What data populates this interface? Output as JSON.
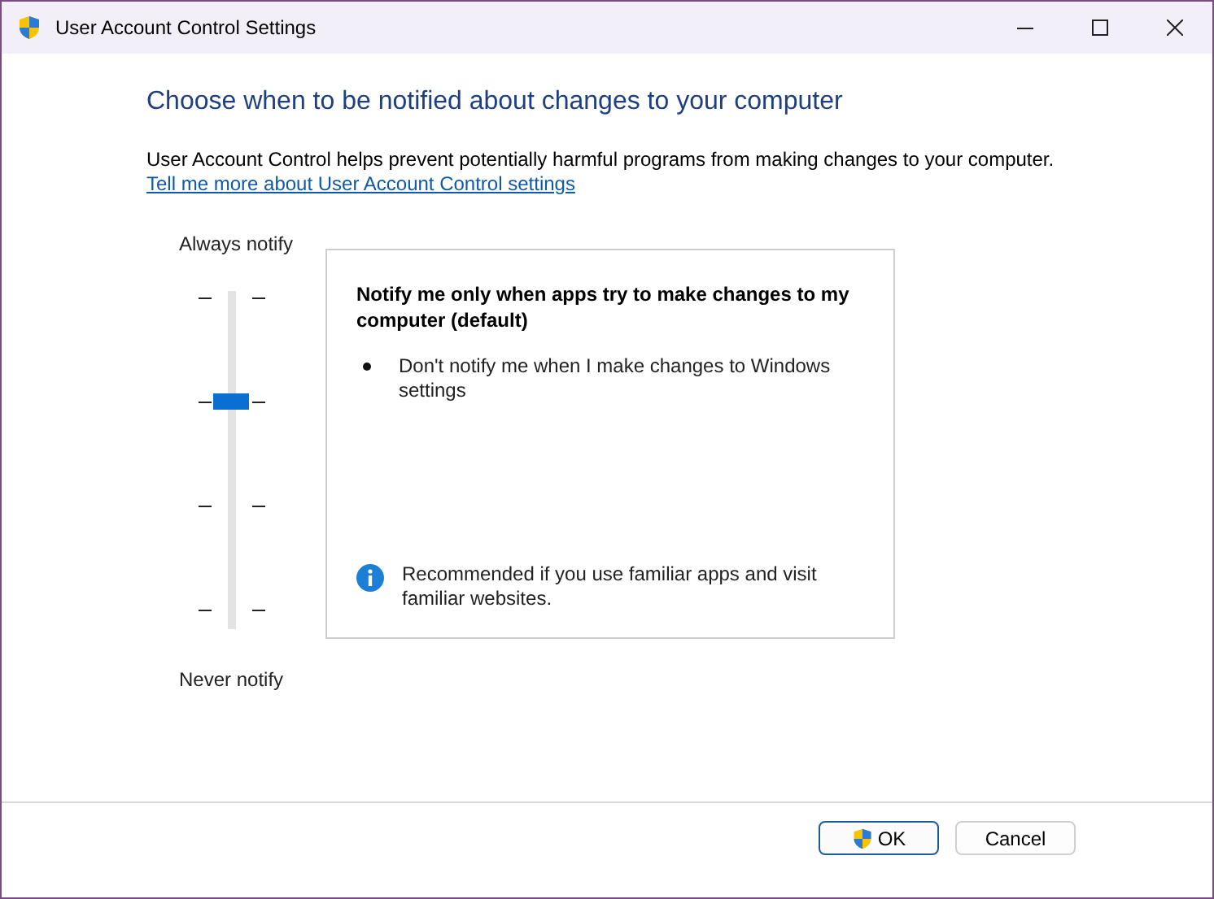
{
  "window": {
    "title": "User Account Control Settings"
  },
  "heading": "Choose when to be notified about changes to your computer",
  "description": "User Account Control helps prevent potentially harmful programs from making changes to your computer.",
  "link": "Tell me more about User Account Control settings",
  "slider": {
    "top_label": "Always notify",
    "bottom_label": "Never notify",
    "level": 0.667
  },
  "panel": {
    "title": "Notify me only when apps try to make changes to my computer (default)",
    "bullets": [
      "Don't notify me when I make changes to Windows settings"
    ],
    "note": "Recommended if you use familiar apps and visit familiar websites."
  },
  "buttons": [
    {
      "label": "OK",
      "kind": "shield"
    },
    {
      "label": "Cancel",
      "kind": "plain"
    }
  ]
}
